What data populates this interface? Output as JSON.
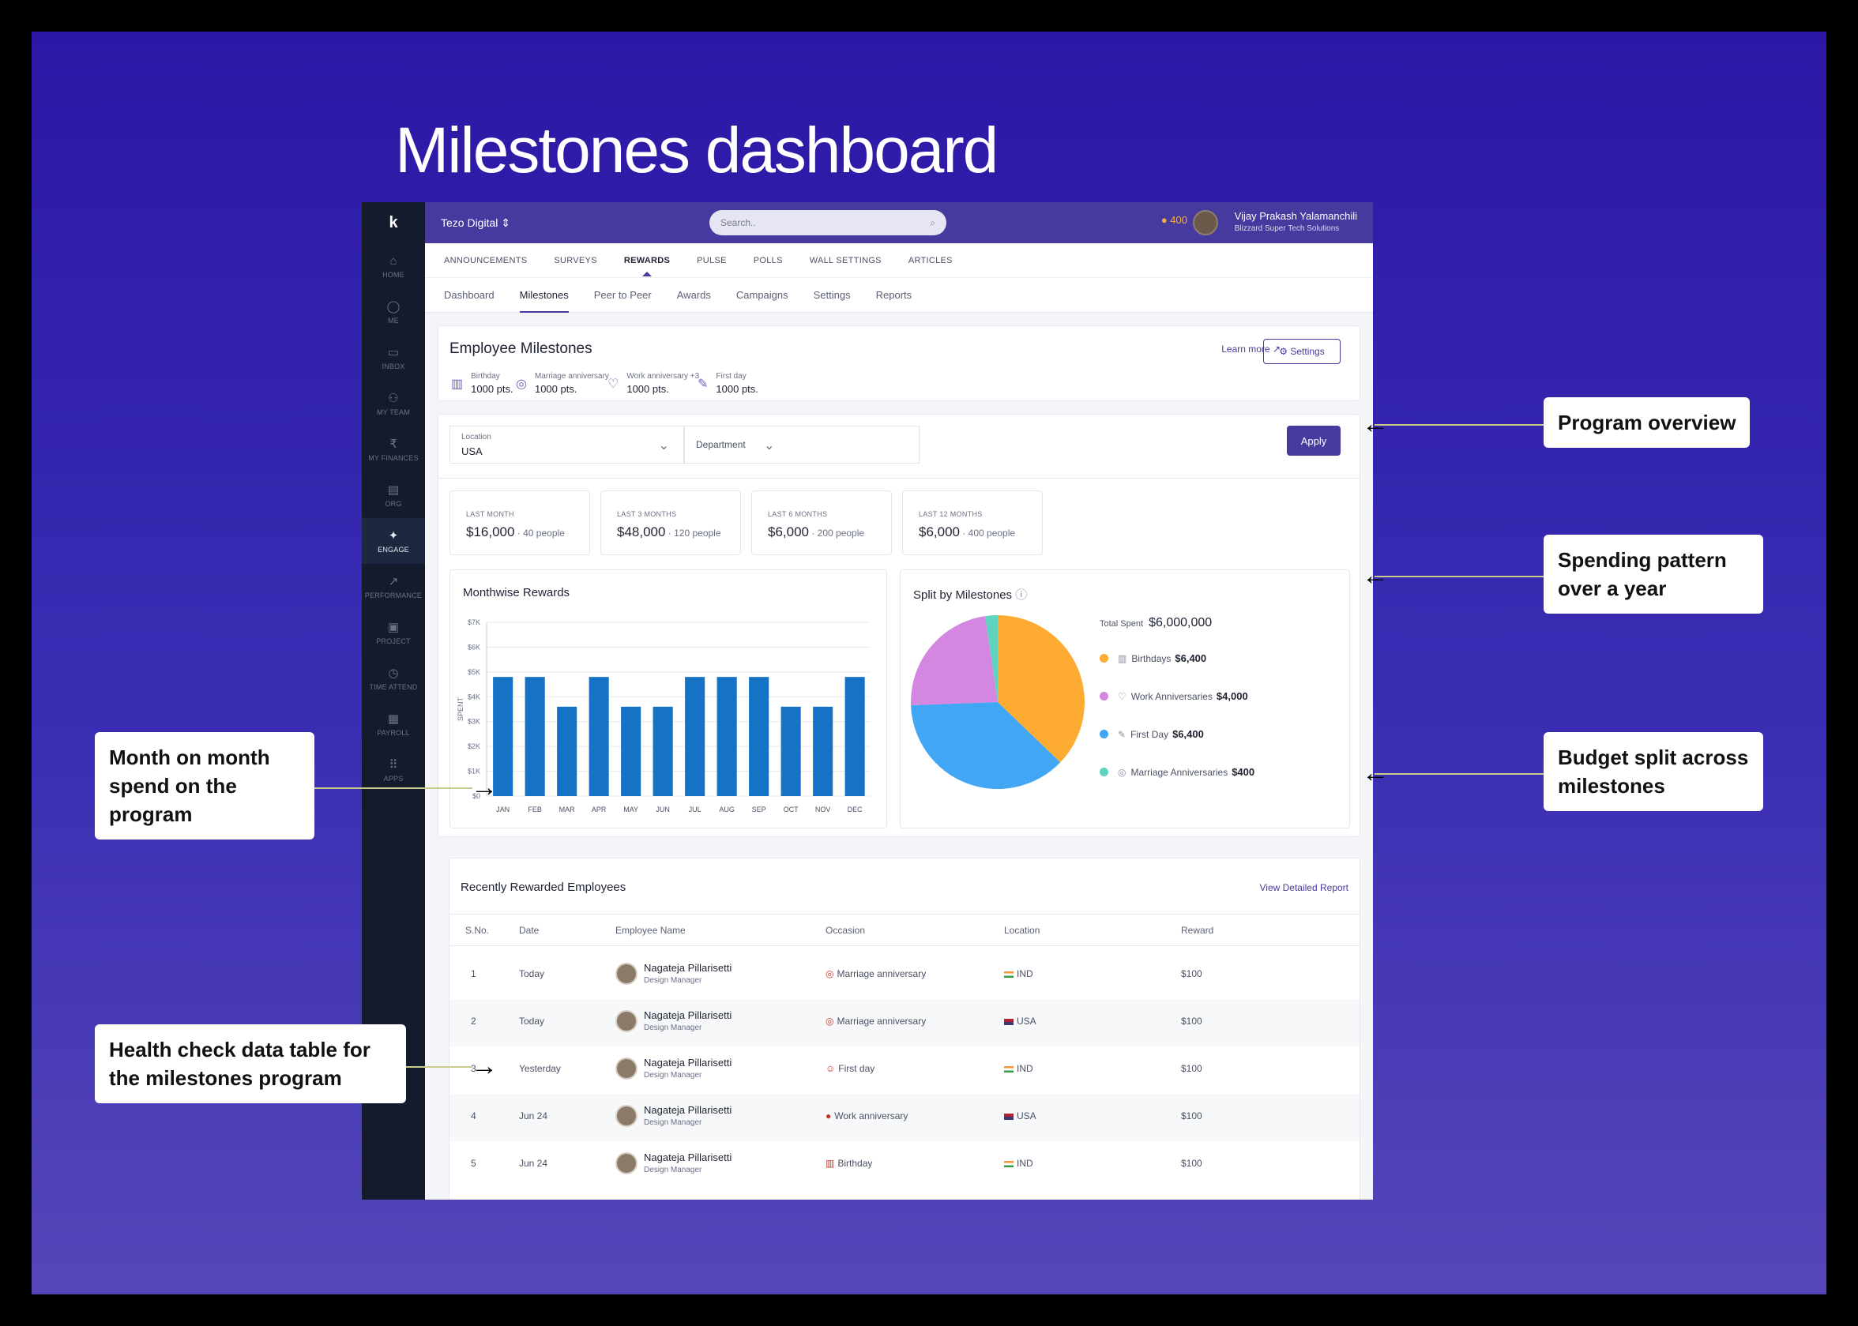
{
  "slide_title": "Milestones dashboard",
  "topbar": {
    "org": "Tezo Digital",
    "search_placeholder": "Search..",
    "coins": "400",
    "user_name": "Vijay Prakash Yalamanchili",
    "user_company": "Blizzard Super Tech Solutions"
  },
  "rail": [
    {
      "icon": "home-icon",
      "glyph": "⌂",
      "label": "HOME"
    },
    {
      "icon": "user-icon",
      "glyph": "◯",
      "label": "ME"
    },
    {
      "icon": "inbox-icon",
      "glyph": "▭",
      "label": "INBOX"
    },
    {
      "icon": "team-icon",
      "glyph": "⚇",
      "label": "MY TEAM"
    },
    {
      "icon": "finances-icon",
      "glyph": "₹",
      "label": "MY FINANCES"
    },
    {
      "icon": "org-icon",
      "glyph": "▤",
      "label": "ORG"
    },
    {
      "icon": "engage-icon",
      "glyph": "✦",
      "label": "ENGAGE"
    },
    {
      "icon": "performance-icon",
      "glyph": "↗",
      "label": "PERFORMANCE"
    },
    {
      "icon": "project-icon",
      "glyph": "▣",
      "label": "PROJECT"
    },
    {
      "icon": "clock-icon",
      "glyph": "◷",
      "label": "TIME ATTEND"
    },
    {
      "icon": "payroll-icon",
      "glyph": "▦",
      "label": "PAYROLL"
    },
    {
      "icon": "apps-icon",
      "glyph": "⠿",
      "label": "APPS"
    }
  ],
  "nav1": [
    "ANNOUNCEMENTS",
    "SURVEYS",
    "REWARDS",
    "PULSE",
    "POLLS",
    "WALL SETTINGS",
    "ARTICLES"
  ],
  "nav2": [
    "Dashboard",
    "Milestones",
    "Peer to Peer",
    "Awards",
    "Campaigns",
    "Settings",
    "Reports"
  ],
  "overview": {
    "title": "Employee Milestones",
    "learn_more": "Learn more",
    "settings": "Settings",
    "milestones": [
      {
        "label": "Birthday",
        "value": "1000 pts.",
        "icon": "cake-icon",
        "glyph": "▥"
      },
      {
        "label": "Marriage anniversary",
        "value": "1000 pts.",
        "icon": "rings-icon",
        "glyph": "◎"
      },
      {
        "label": "Work anniversary +3",
        "value": "1000 pts.",
        "icon": "balloon-icon",
        "glyph": "♡"
      },
      {
        "label": "First day",
        "value": "1000 pts.",
        "icon": "handshake-icon",
        "glyph": "✎"
      }
    ]
  },
  "filters": {
    "location_label": "Location",
    "location_value": "USA",
    "department_label": "Department",
    "apply": "Apply"
  },
  "stats": [
    {
      "period": "LAST MONTH",
      "amount": "$16,000",
      "people": " · 40 people"
    },
    {
      "period": "LAST 3 MONTHS",
      "amount": "$48,000",
      "people": " · 120 people"
    },
    {
      "period": "LAST 6 MONTHS",
      "amount": "$6,000",
      "people": " · 200 people"
    },
    {
      "period": "LAST 12 MONTHS",
      "amount": "$6,000",
      "people": " · 400 people"
    }
  ],
  "chart_data": [
    {
      "type": "bar",
      "title": "Monthwise Rewards",
      "ylabel": "SPENT",
      "xlabel": "",
      "ylim": [
        0,
        7000
      ],
      "yticks": [
        "$0",
        "$1K",
        "$2K",
        "$3K",
        "$4K",
        "$5K",
        "$6K",
        "$7K"
      ],
      "categories": [
        "JAN",
        "FEB",
        "MAR",
        "APR",
        "MAY",
        "JUN",
        "JUL",
        "AUG",
        "SEP",
        "OCT",
        "NOV",
        "DEC"
      ],
      "values": [
        4800,
        4800,
        3600,
        4800,
        3600,
        3600,
        4800,
        4800,
        4800,
        3600,
        3600,
        4800
      ],
      "color": "#1672c4"
    },
    {
      "type": "pie",
      "title": "Split by Milestones",
      "total_label": "Total Spent",
      "total_value": "$6,000,000",
      "slices": [
        {
          "name": "Birthdays",
          "value": 6400,
          "display": "$6,400",
          "color": "#fdab32",
          "icon": "cake-icon"
        },
        {
          "name": "Work Anniversaries",
          "value": 4000,
          "display": "$4,000",
          "color": "#d387e0",
          "icon": "balloon-icon"
        },
        {
          "name": "First Day",
          "value": 6400,
          "display": "$6,400",
          "color": "#41a6f3",
          "icon": "handshake-icon"
        },
        {
          "name": "Marriage Anniversaries",
          "value": 400,
          "display": "$400",
          "color": "#60d3be",
          "icon": "rings-icon"
        }
      ]
    }
  ],
  "table": {
    "title": "Recently Rewarded Employees",
    "link": "View Detailed Report",
    "headers": [
      "S.No.",
      "Date",
      "Employee Name",
      "Occasion",
      "Location",
      "Reward"
    ],
    "rows": [
      {
        "no": "1",
        "date": "Today",
        "name": "Nagateja Pillarisetti",
        "role": "Design Manager",
        "occasion": "Marriage anniversary",
        "occ_glyph": "◎",
        "location": "IND",
        "reward": "$100"
      },
      {
        "no": "2",
        "date": "Today",
        "name": "Nagateja Pillarisetti",
        "role": "Design Manager",
        "occasion": "Marriage anniversary",
        "occ_glyph": "◎",
        "location": "USA",
        "reward": "$100"
      },
      {
        "no": "3",
        "date": "Yesterday",
        "name": "Nagateja Pillarisetti",
        "role": "Design Manager",
        "occasion": "First day",
        "occ_glyph": "☺",
        "location": "IND",
        "reward": "$100"
      },
      {
        "no": "4",
        "date": "Jun 24",
        "name": "Nagateja Pillarisetti",
        "role": "Design Manager",
        "occasion": "Work anniversary",
        "occ_glyph": "●",
        "location": "USA",
        "reward": "$100"
      },
      {
        "no": "5",
        "date": "Jun 24",
        "name": "Nagateja Pillarisetti",
        "role": "Design Manager",
        "occasion": "Birthday",
        "occ_glyph": "▥",
        "location": "IND",
        "reward": "$100"
      }
    ]
  },
  "callouts": [
    "Program overview",
    "Spending pattern over a year",
    "Budget split across milestones",
    "Month on month spend on the program",
    "Health check data table for the milestones program"
  ]
}
